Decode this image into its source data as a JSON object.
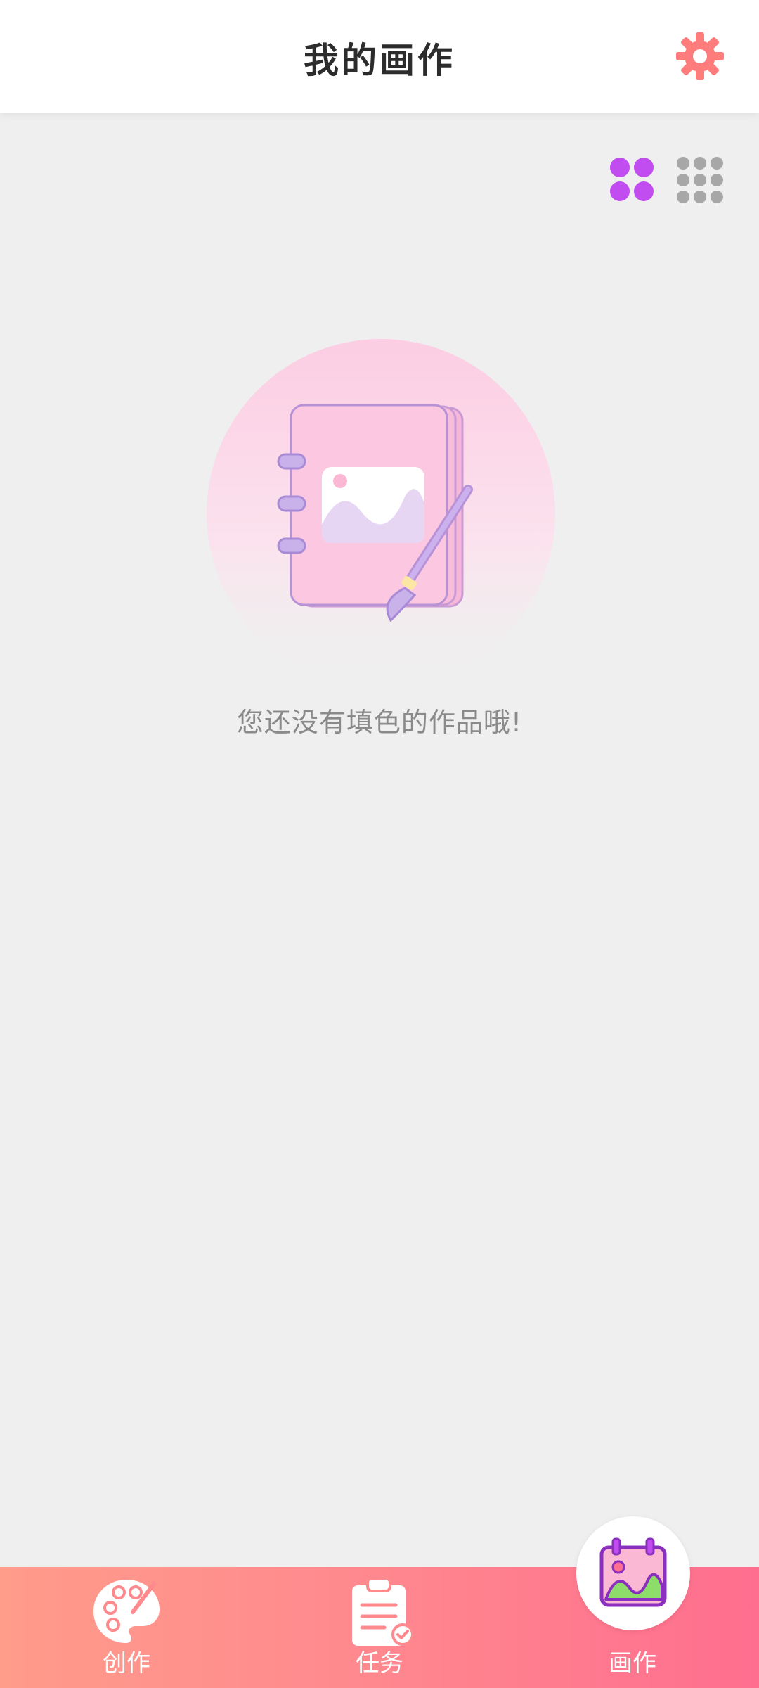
{
  "header": {
    "title": "我的画作"
  },
  "icons": {
    "settings": "gear-icon",
    "view_large": "grid-2x2-icon",
    "view_small": "grid-3x3-icon"
  },
  "view_toggle": {
    "selected": "large",
    "active_color": "#c14cf0",
    "inactive_color": "#a7a7a7"
  },
  "empty_state": {
    "message": "您还没有填色的作品哦!"
  },
  "tabs": [
    {
      "label": "创作",
      "icon": "palette-icon",
      "active": false
    },
    {
      "label": "任务",
      "icon": "clipboard-check-icon",
      "active": false
    },
    {
      "label": "画作",
      "icon": "picture-calendar-icon",
      "active": true
    }
  ],
  "colors": {
    "accent": "#ff7b8b",
    "tabbar_start": "#ff9c8a",
    "tabbar_end": "#ff6e8f",
    "settings_icon": "#ff7c7c"
  }
}
